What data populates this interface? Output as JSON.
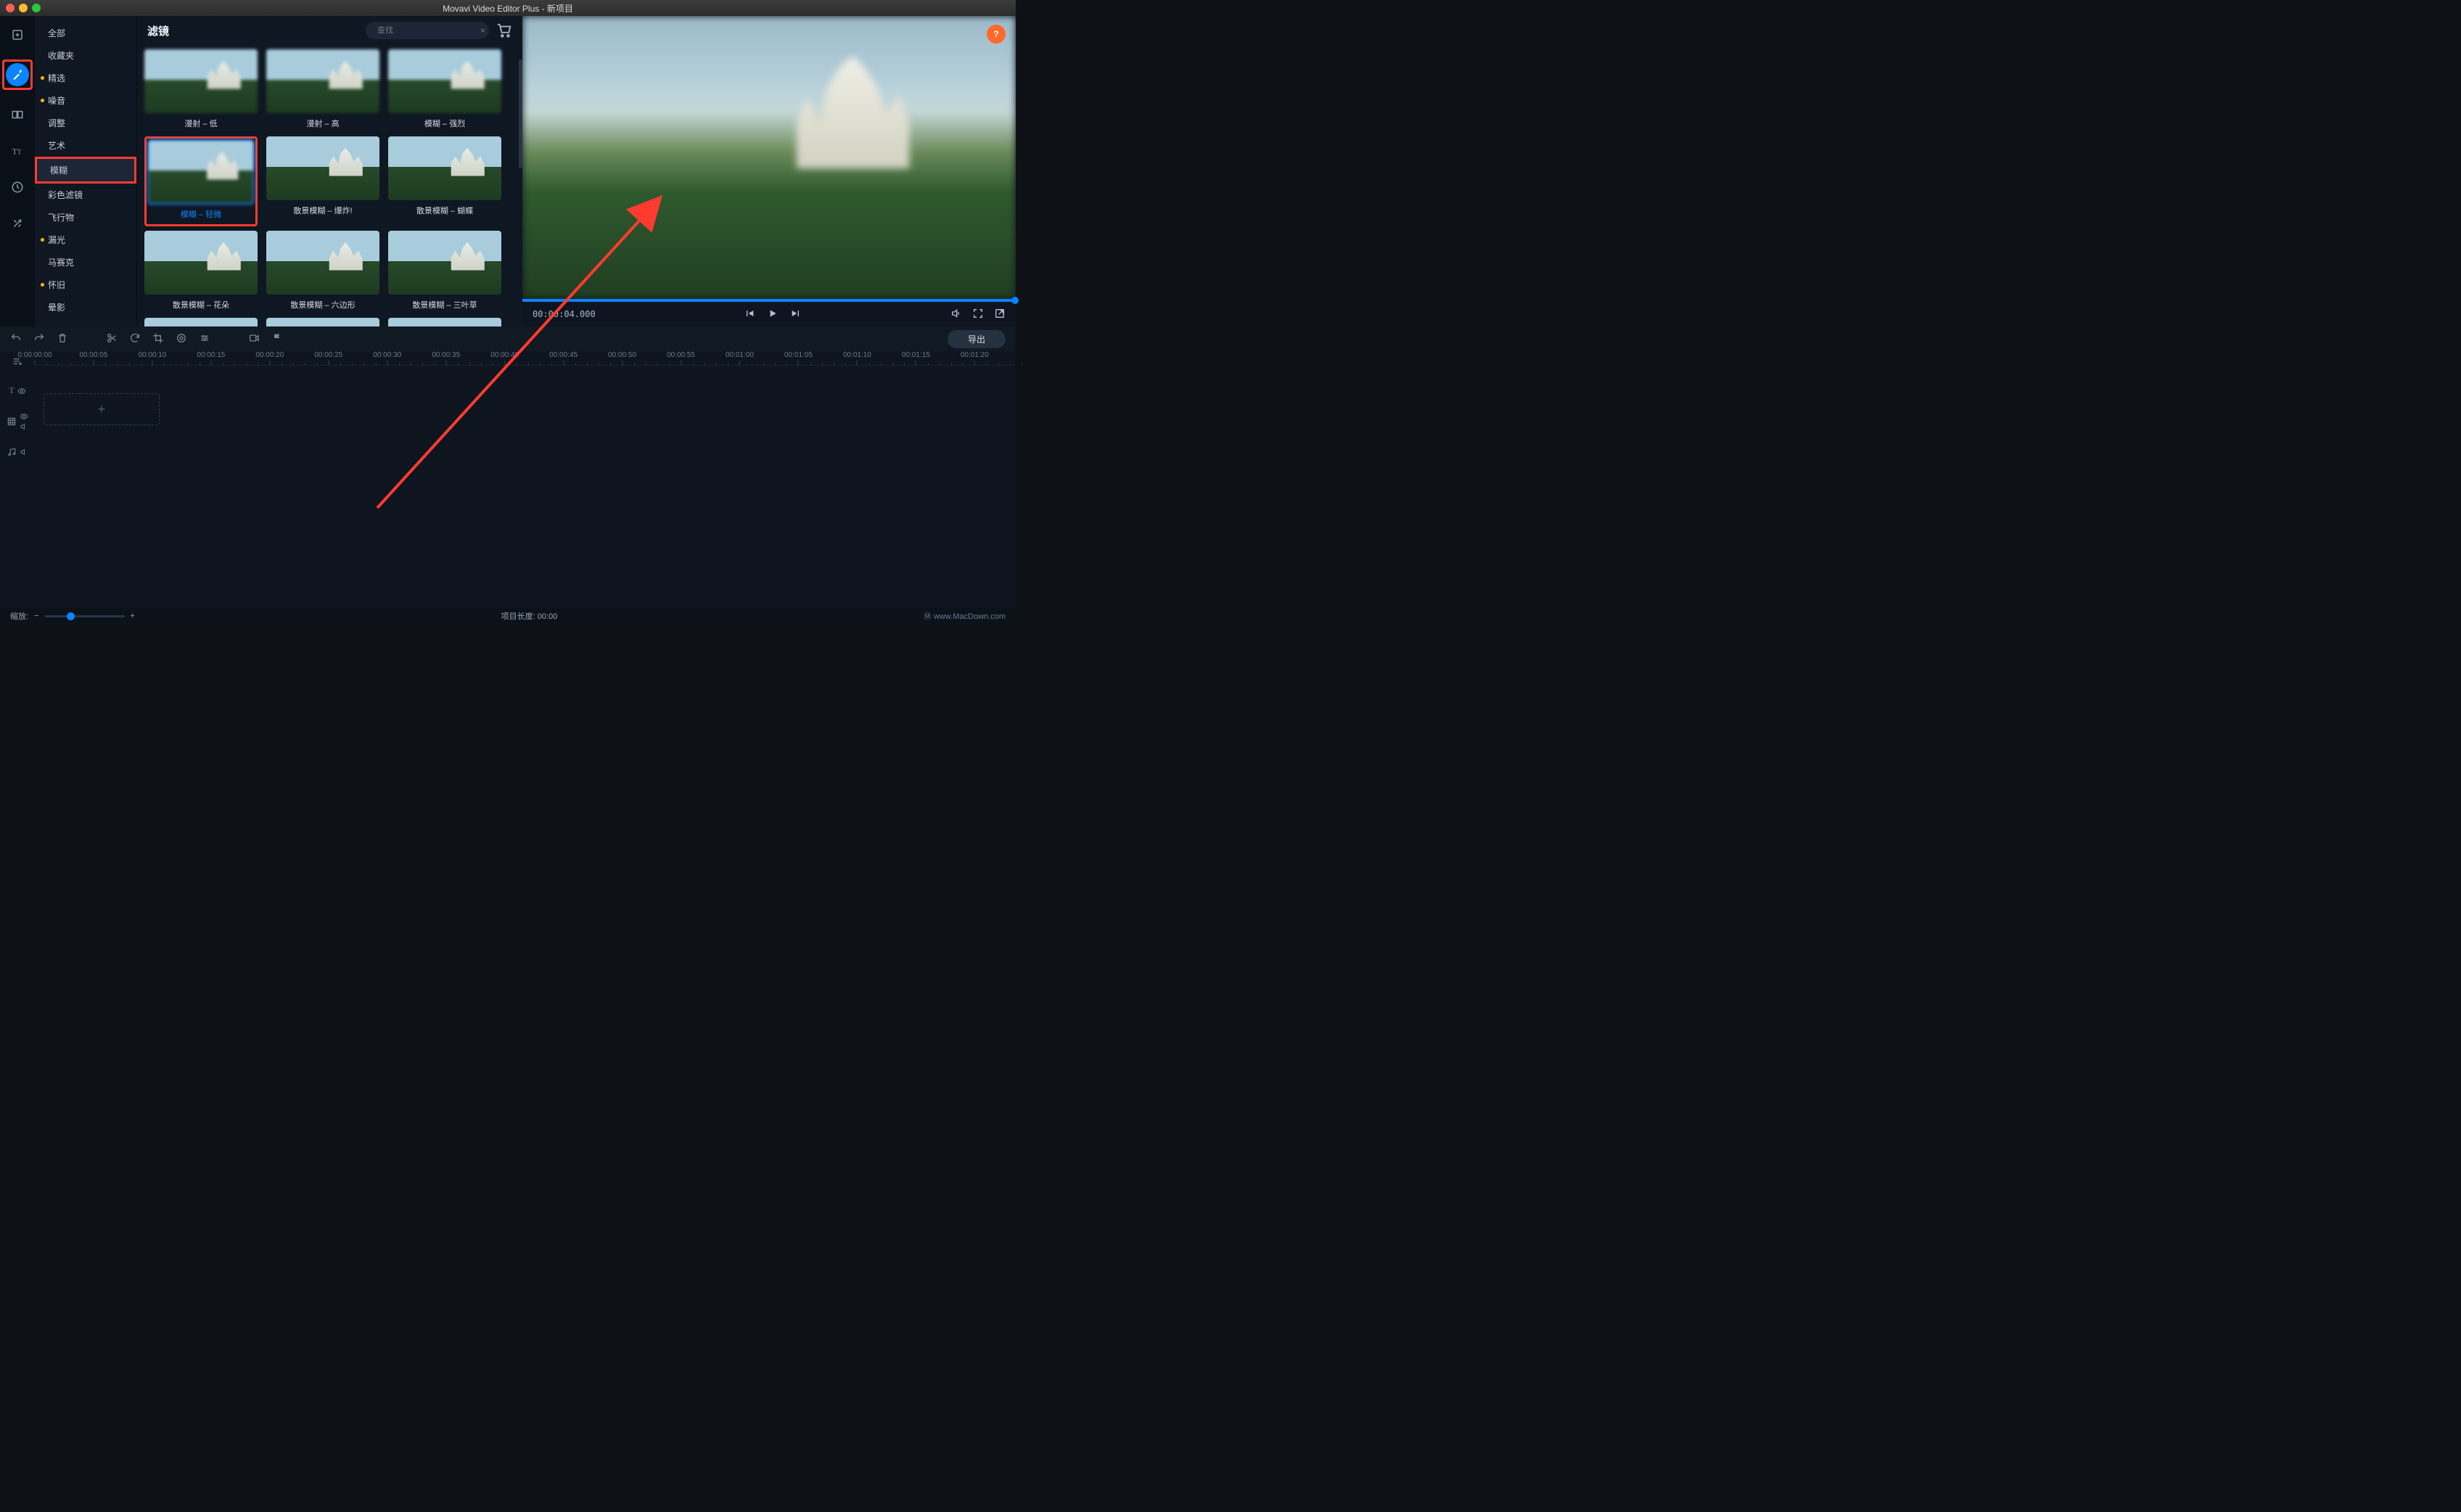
{
  "titlebar": {
    "title": "Movavi Video Editor Plus - 新项目"
  },
  "categories": {
    "items": [
      {
        "label": "全部",
        "new": false
      },
      {
        "label": "收藏夹",
        "new": false
      },
      {
        "label": "精选",
        "new": true
      },
      {
        "label": "噪音",
        "new": true
      },
      {
        "label": "调整",
        "new": false
      },
      {
        "label": "艺术",
        "new": false
      },
      {
        "label": "模糊",
        "new": false,
        "active": true
      },
      {
        "label": "彩色滤镜",
        "new": false
      },
      {
        "label": "飞行物",
        "new": false
      },
      {
        "label": "漏光",
        "new": true
      },
      {
        "label": "马赛克",
        "new": false
      },
      {
        "label": "怀旧",
        "new": true
      },
      {
        "label": "晕影",
        "new": false
      }
    ]
  },
  "panel": {
    "title": "滤镜",
    "search_placeholder": "查找"
  },
  "filters": [
    {
      "label": "漫射 – 低"
    },
    {
      "label": "漫射 – 高"
    },
    {
      "label": "模糊 – 强烈"
    },
    {
      "label": "模糊 – 轻微",
      "selected": true,
      "highlight": true
    },
    {
      "label": "散景模糊 – 爆炸!"
    },
    {
      "label": "散景模糊 – 蝴蝶"
    },
    {
      "label": "散景模糊 – 花朵"
    },
    {
      "label": "散景模糊 – 六边形"
    },
    {
      "label": "散景模糊 – 三叶草"
    },
    {
      "label": ""
    },
    {
      "label": ""
    },
    {
      "label": ""
    }
  ],
  "preview": {
    "timecode": "00:00:04.000",
    "help": "?"
  },
  "timeline": {
    "export_label": "导出",
    "ticks": [
      "0:00:00:00",
      "00:00:05",
      "00:00:10",
      "00:00:15",
      "00:00:20",
      "00:00:25",
      "00:00:30",
      "00:00:35",
      "00:00:40",
      "00:00:45",
      "00:00:50",
      "00:00:55",
      "00:01:00",
      "00:01:05",
      "00:01:10",
      "00:01:15",
      "00:01:20"
    ],
    "add": "+"
  },
  "status": {
    "zoom_label": "缩放:",
    "duration_label": "项目长度:",
    "duration_value": "00:00",
    "watermark": "Ⓜ www.MacDown.com"
  }
}
